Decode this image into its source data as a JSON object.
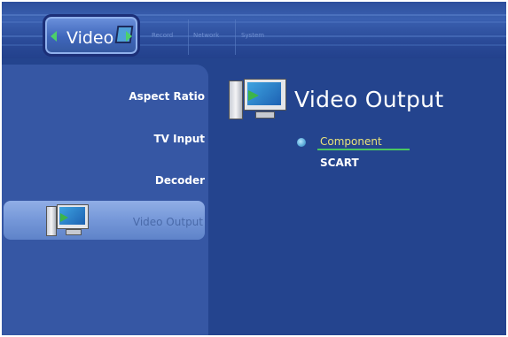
{
  "topbar": {
    "active_tab": "Video",
    "tabs": [
      "Record",
      "Network",
      "System"
    ]
  },
  "sidebar": {
    "items": [
      {
        "label": "Aspect Ratio"
      },
      {
        "label": "TV Input"
      },
      {
        "label": "Decoder"
      },
      {
        "label": "Video Output",
        "selected": true
      }
    ]
  },
  "content": {
    "title": "Video Output",
    "options": [
      {
        "label": "Component",
        "selected": true
      },
      {
        "label": "SCART",
        "selected": false
      }
    ]
  },
  "colors": {
    "background": "#24448e",
    "panel": "#3657a4",
    "highlight": "#7597d8",
    "selected_option_text": "#e8e27a",
    "accent_green": "#49c860"
  },
  "icons": {
    "tab_arrows": "chevron-left-right-icon",
    "pc": "computer-icon"
  }
}
